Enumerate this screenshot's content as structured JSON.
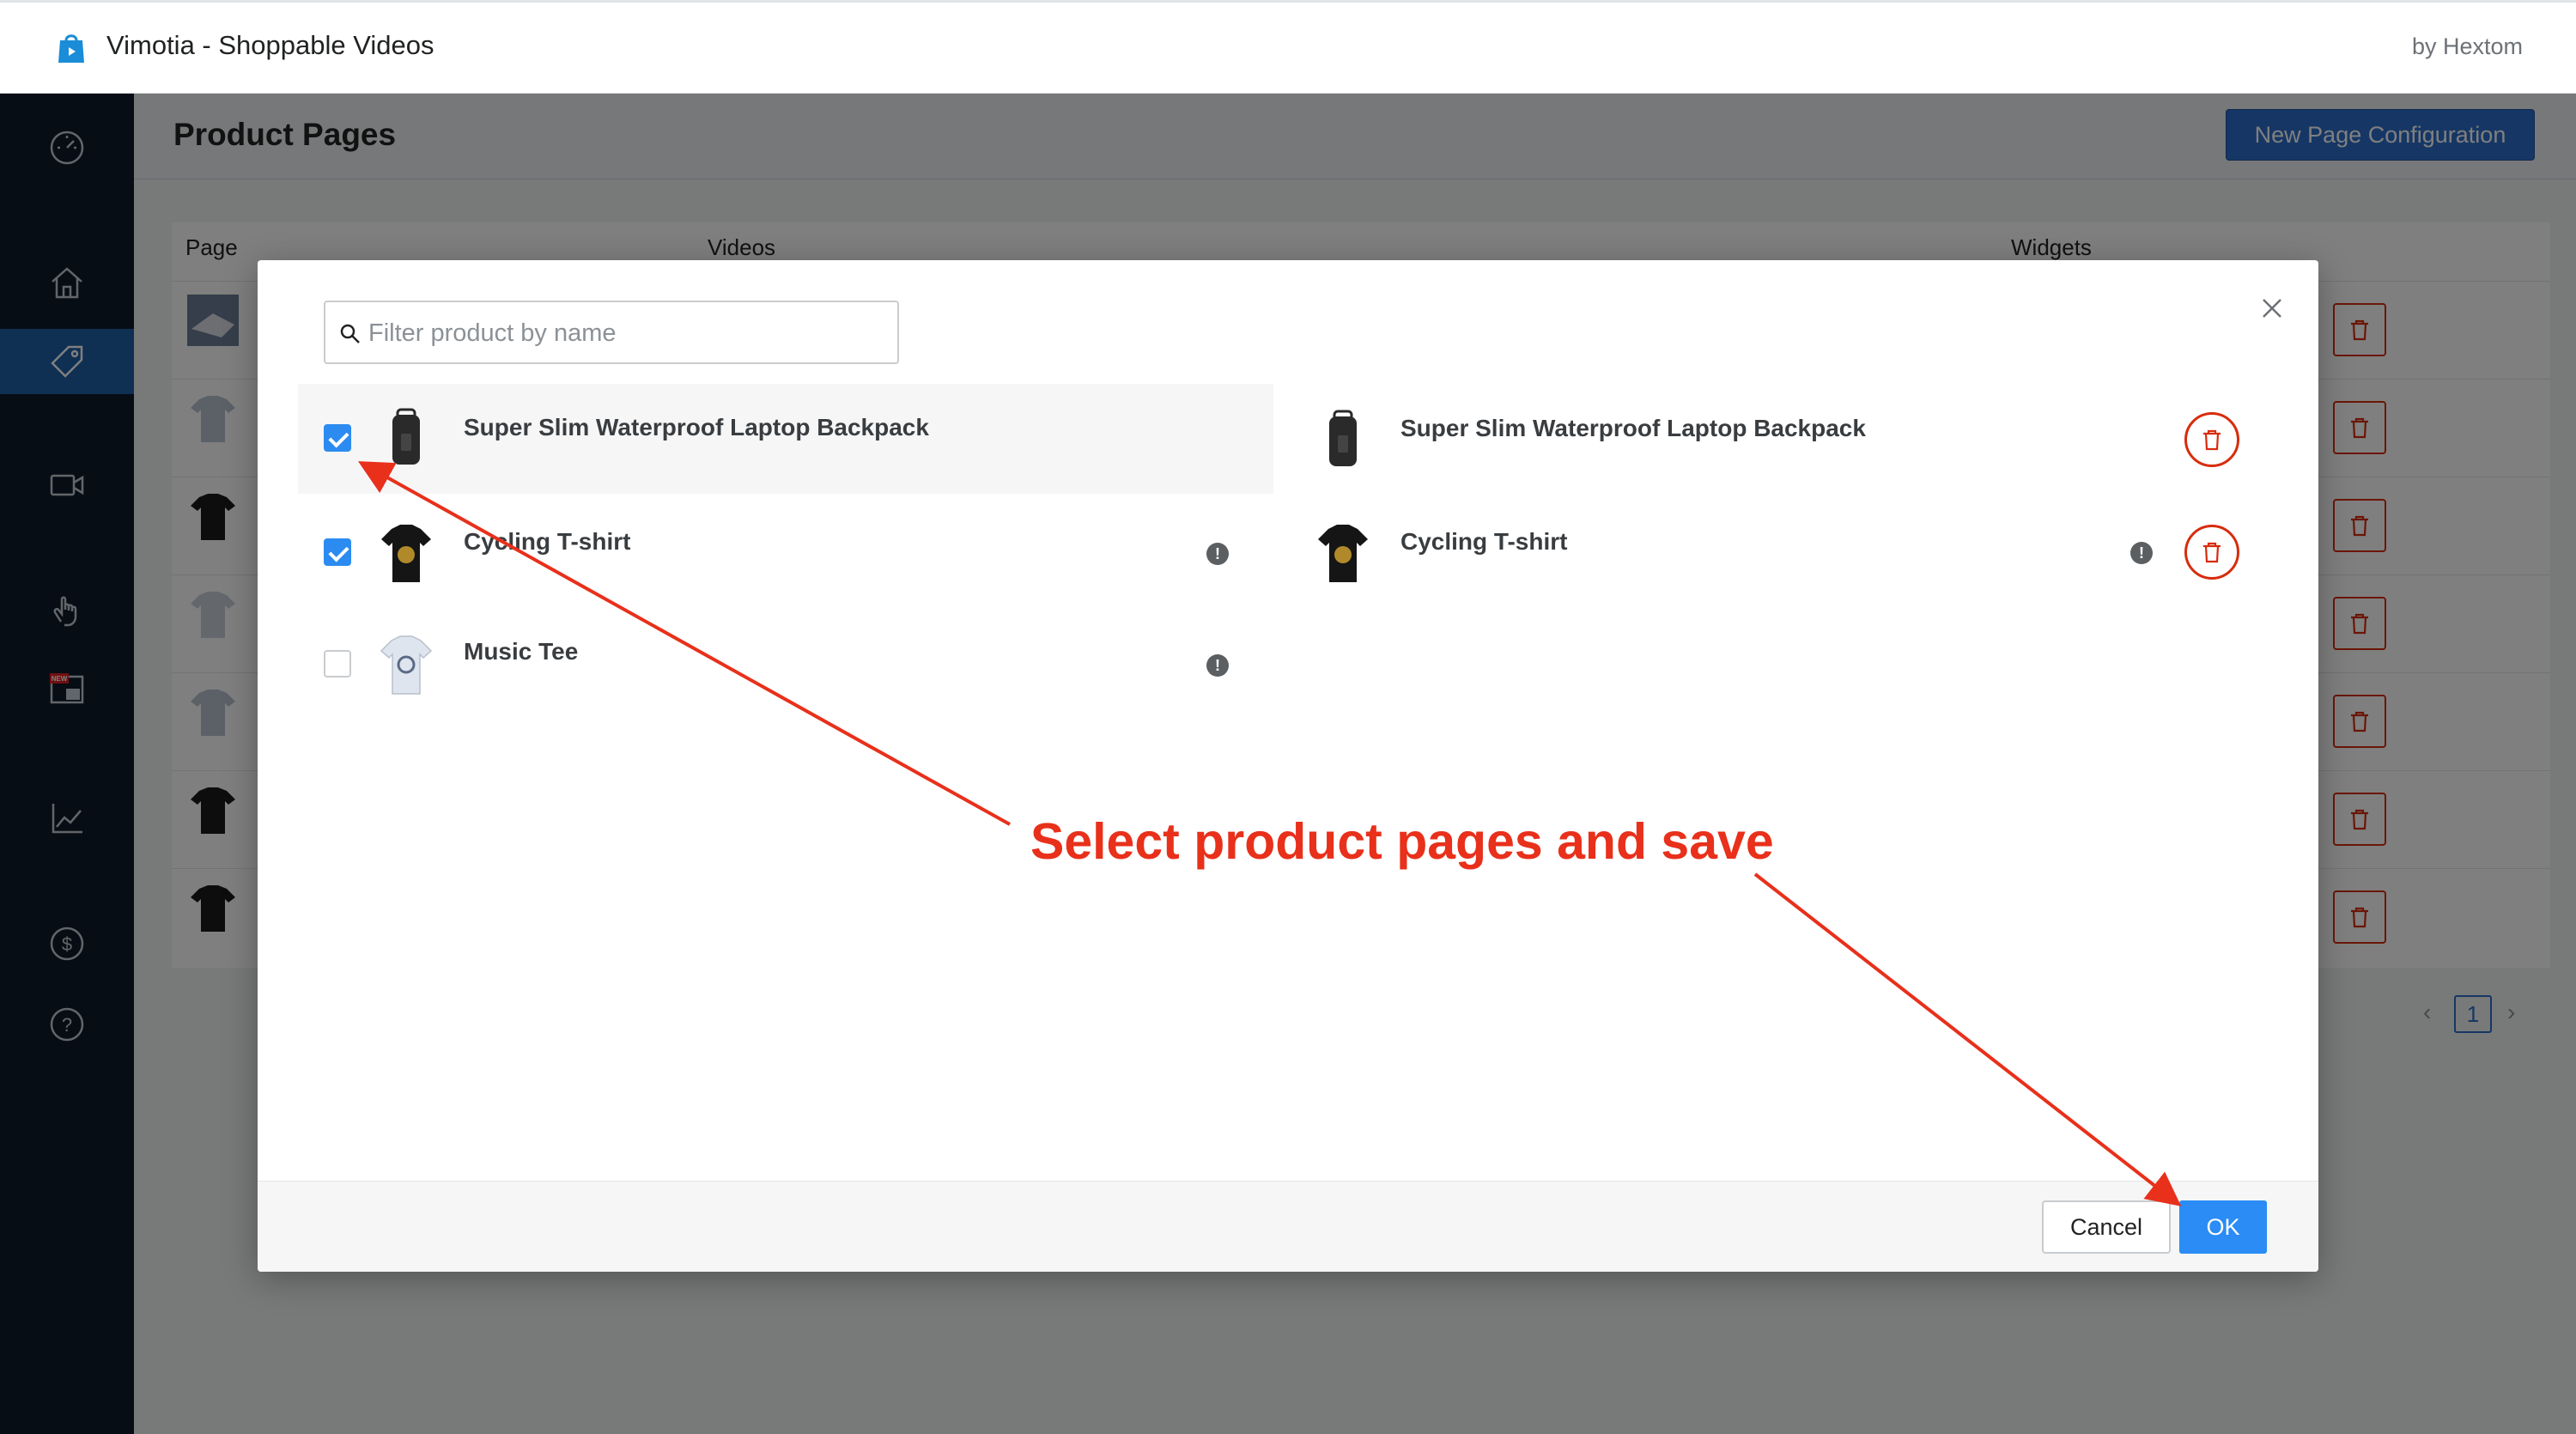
{
  "header": {
    "app_title": "Vimotia - Shoppable Videos",
    "by_text": "by Hextom"
  },
  "sidebar": {
    "items": [
      {
        "icon": "dashboard-icon",
        "active": false
      },
      {
        "icon": "home-icon",
        "active": false
      },
      {
        "icon": "tag-icon",
        "active": true
      },
      {
        "icon": "video-icon",
        "active": false
      },
      {
        "icon": "hand-pointer-icon",
        "active": false
      },
      {
        "icon": "new-widget-icon",
        "active": false,
        "badge": "NEW"
      },
      {
        "icon": "analytics-icon",
        "active": false
      },
      {
        "icon": "dollar-icon",
        "active": false
      },
      {
        "icon": "help-icon",
        "active": false
      }
    ]
  },
  "page": {
    "title": "Product Pages",
    "new_config_label": "New Page Configuration",
    "columns": [
      "Page",
      "Videos",
      "Widgets"
    ],
    "pagination": {
      "current": "1",
      "prev": "‹",
      "next": "›"
    }
  },
  "modal": {
    "filter_placeholder": "Filter product by name",
    "left_products": [
      {
        "name": "Super Slim Waterproof Laptop Backpack",
        "checked": true,
        "thumb": "backpack",
        "info": false
      },
      {
        "name": "Cycling T-shirt",
        "checked": true,
        "thumb": "black-tee",
        "info": true
      },
      {
        "name": "Music Tee",
        "checked": false,
        "thumb": "white-tee",
        "info": true
      }
    ],
    "selected_products": [
      {
        "name": "Super Slim Waterproof Laptop Backpack",
        "thumb": "backpack",
        "info": false
      },
      {
        "name": "Cycling T-shirt",
        "thumb": "black-tee",
        "info": true
      }
    ],
    "info_glyph": "!",
    "cancel_label": "Cancel",
    "ok_label": "OK"
  },
  "annotation": {
    "text": "Select product pages and save",
    "color": "#e8301b"
  },
  "colors": {
    "accent": "#2c6ecb",
    "ok": "#2a8cf4",
    "danger": "#d72c0d",
    "sidebar_bg": "#0f1b2b",
    "sidebar_active": "#1f5fa6"
  }
}
